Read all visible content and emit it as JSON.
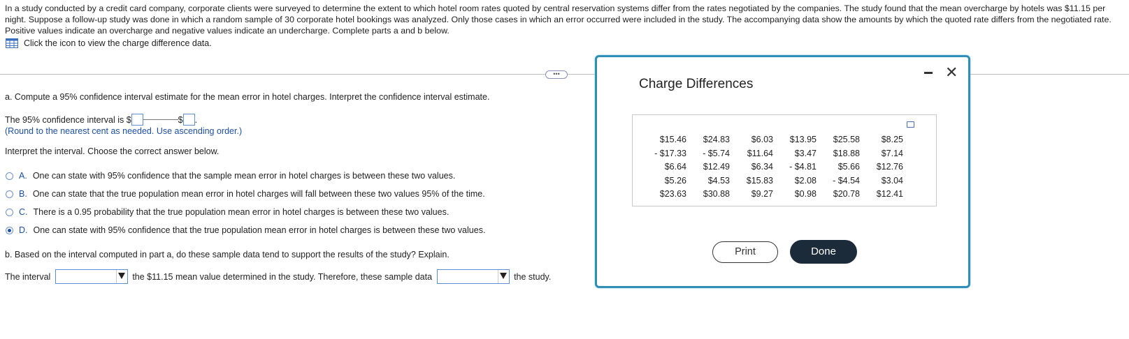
{
  "intro": "In a study conducted by a credit card company, corporate clients were surveyed to determine the extent to which hotel room rates quoted by central reservation systems differ from the rates negotiated by the companies. The study found that the mean overcharge by hotels was $11.15 per night. Suppose a follow-up study was done in which a random sample of 30 corporate hotel bookings was analyzed. Only those cases in which an error occurred were included in the study. The accompanying data show the amounts by which the quoted rate differs from the negotiated rate. Positive values indicate an overcharge and negative values indicate an undercharge. Complete parts a and b below.",
  "data_link": "Click the icon to view the charge difference data.",
  "part_a": {
    "question": "a. Compute a 95% confidence interval estimate for the mean error in hotel charges. Interpret the confidence interval estimate.",
    "ci_prefix": "The 95% confidence interval is $",
    "ci_mid": "$",
    "ci_suffix": ".",
    "round_note": "(Round to the nearest cent as needed. Use ascending order.)",
    "interpret_prompt": "Interpret the interval. Choose the correct answer below.",
    "options": [
      {
        "letter": "A.",
        "text": "One can state with 95% confidence that the sample mean error in hotel charges is between these two values.",
        "selected": false
      },
      {
        "letter": "B.",
        "text": "One can state that the true population mean error in hotel charges will fall between these two values 95% of the time.",
        "selected": false
      },
      {
        "letter": "C.",
        "text": "There is a 0.95 probability that the true population mean error in hotel charges is between these two values.",
        "selected": false
      },
      {
        "letter": "D.",
        "text": "One can state with 95% confidence that the true population mean error in hotel charges is between these two values.",
        "selected": true
      }
    ]
  },
  "part_b": {
    "question": "b. Based on the interval computed in part a, do these sample data tend to support the results of the study? Explain.",
    "prefix": "The interval",
    "middle": "the $11.15 mean value determined in the study. Therefore, these sample data",
    "suffix": "the study."
  },
  "dialog": {
    "title": "Charge Differences",
    "print_label": "Print",
    "done_label": "Done",
    "rows": [
      [
        "$15.46",
        "$24.83",
        "$6.03",
        "$13.95",
        "$25.58",
        "$8.25"
      ],
      [
        "- $17.33",
        "- $5.74",
        "$11.64",
        "$3.47",
        "$18.88",
        "$7.14"
      ],
      [
        "$6.64",
        "$12.49",
        "$6.34",
        "- $4.81",
        "$5.66",
        "$12.76"
      ],
      [
        "$5.26",
        "$4.53",
        "$15.83",
        "$2.08",
        "- $4.54",
        "$3.04"
      ],
      [
        "$23.63",
        "$30.88",
        "$9.27",
        "$0.98",
        "$20.78",
        "$12.41"
      ]
    ]
  },
  "icons": {
    "data_table": "table-icon",
    "more": "ellipsis-icon",
    "minimize": "minimize-icon",
    "close": "close-icon",
    "copy": "copy-icon"
  },
  "colors": {
    "accent": "#1d4fa0",
    "dialog_border": "#2f8fb8",
    "done_bg": "#1c2b3a"
  }
}
